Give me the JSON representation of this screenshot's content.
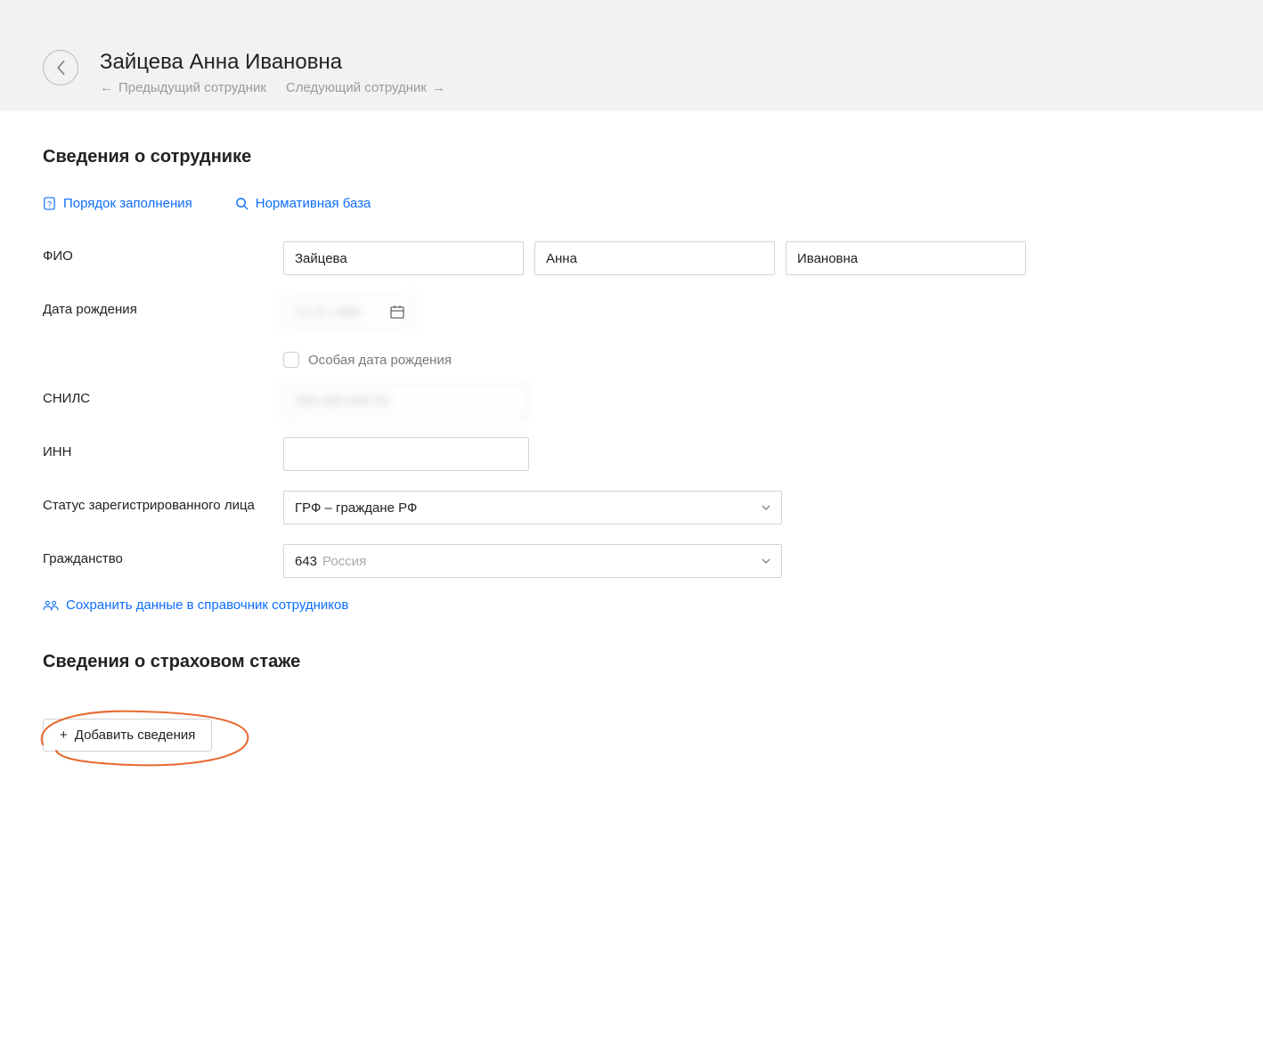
{
  "header": {
    "title": "Зайцева Анна Ивановна",
    "prev_label": "Предыдущий сотрудник",
    "next_label": "Следующий сотрудник"
  },
  "section1_title": "Сведения о сотруднике",
  "links": {
    "fill_order": "Порядок заполнения",
    "normative": "Нормативная база"
  },
  "labels": {
    "fio": "ФИО",
    "birthdate": "Дата рождения",
    "special_birth": "Особая дата рождения",
    "snils": "СНИЛС",
    "inn": "ИНН",
    "status": "Статус зарегистрированного лица",
    "citizenship": "Гражданство"
  },
  "values": {
    "lastname": "Зайцева",
    "firstname": "Анна",
    "patronymic": "Ивановна",
    "birthdate_masked": "01.01.1980",
    "snils_masked": "000-000-000 00",
    "inn": "",
    "status": "ГРФ – граждане РФ",
    "citizenship_code": "643",
    "citizenship_name": "Россия"
  },
  "save_to_dir": "Сохранить данные в справочник сотрудников",
  "section2_title": "Сведения о страховом стаже",
  "add_button": "Добавить сведения"
}
